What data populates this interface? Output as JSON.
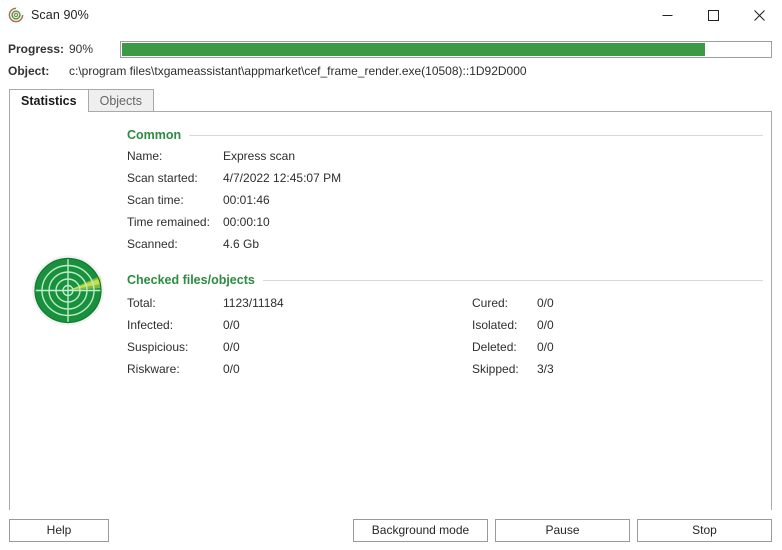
{
  "window": {
    "title": "Scan 90%",
    "icon": "scan-spiral-icon",
    "minimize_label": "—",
    "maximize_label": "□",
    "close_label": "✕"
  },
  "progress": {
    "label": "Progress:",
    "percent_text": "90%",
    "percent_value": 90,
    "bar_color": "#3b9a43"
  },
  "object": {
    "label": "Object:",
    "value": "c:\\program files\\txgameassistant\\appmarket\\cef_frame_render.exe(10508)::1D92D000"
  },
  "tabs": [
    {
      "label": "Statistics",
      "active": true
    },
    {
      "label": "Objects",
      "active": false
    }
  ],
  "radar": {
    "icon": "radar-scanner-icon",
    "disc_color": "#19903c",
    "ring_color": "#b9e8c4",
    "sweep_color": "#d8e84a"
  },
  "sections": {
    "common": {
      "title": "Common",
      "title_color": "#2e8b42",
      "rows": [
        {
          "key": "Name:",
          "value": "Express scan"
        },
        {
          "key": "Scan started:",
          "value": "4/7/2022 12:45:07 PM"
        },
        {
          "key": "Scan time:",
          "value": "00:01:46"
        },
        {
          "key": "Time remained:",
          "value": "00:00:10"
        },
        {
          "key": "Scanned:",
          "value": "4.6 Gb"
        }
      ]
    },
    "checked": {
      "title": "Checked files/objects",
      "title_color": "#2e8b42",
      "left_rows": [
        {
          "key": "Total:",
          "value": "1123/11184"
        },
        {
          "key": "Infected:",
          "value": "0/0"
        },
        {
          "key": "Suspicious:",
          "value": "0/0"
        },
        {
          "key": "Riskware:",
          "value": "0/0"
        }
      ],
      "right_rows": [
        {
          "key": "Cured:",
          "value": "0/0"
        },
        {
          "key": "Isolated:",
          "value": "0/0"
        },
        {
          "key": "Deleted:",
          "value": "0/0"
        },
        {
          "key": "Skipped:",
          "value": "3/3"
        }
      ]
    }
  },
  "footer": {
    "help_label": "Help",
    "background_mode_label": "Background mode",
    "pause_label": "Pause",
    "stop_label": "Stop"
  }
}
